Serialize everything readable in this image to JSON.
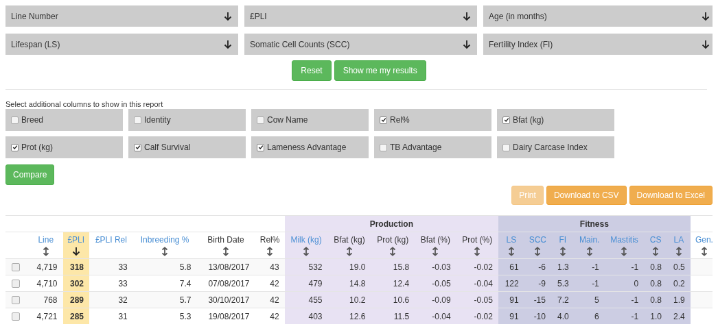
{
  "filters": [
    {
      "label": "Line Number"
    },
    {
      "label": "£PLI"
    },
    {
      "label": "Age (in months)"
    },
    {
      "label": "Lifespan (LS)"
    },
    {
      "label": "Somatic Cell Counts (SCC)"
    },
    {
      "label": "Fertility Index (FI)"
    }
  ],
  "filter_buttons": [
    {
      "label": "Reset"
    },
    {
      "label": "Show me my results"
    }
  ],
  "columns_prompt": "Select additional columns to show in this report",
  "column_options": [
    {
      "label": "Breed",
      "checked": false
    },
    {
      "label": "Identity",
      "checked": false
    },
    {
      "label": "Cow Name",
      "checked": false
    },
    {
      "label": "Rel%",
      "checked": true
    },
    {
      "label": "Bfat (kg)",
      "checked": true
    },
    {
      "label": "Prot (kg)",
      "checked": true
    },
    {
      "label": "Calf Survival",
      "checked": true
    },
    {
      "label": "Lameness Advantage",
      "checked": true
    },
    {
      "label": "TB Advantage",
      "checked": false
    },
    {
      "label": "Dairy Carcase Index",
      "checked": false
    }
  ],
  "compare_button": "Compare",
  "export_buttons": [
    {
      "label": "Print",
      "disabled": true
    },
    {
      "label": "Download to CSV",
      "disabled": false
    },
    {
      "label": "Download to Excel",
      "disabled": false
    }
  ],
  "table": {
    "column_groups": [
      {
        "kind": "plain",
        "columns": [
          {
            "label": "Line",
            "link": true,
            "sortable": true,
            "sorted": false
          },
          {
            "label": "£PLI",
            "link": true,
            "sortable": true,
            "sorted": true
          },
          {
            "label": "£PLI Rel",
            "link": true,
            "sortable": false,
            "sorted": false
          },
          {
            "label": "Inbreeding %",
            "link": true,
            "sortable": true,
            "sorted": false
          },
          {
            "label": "Birth Date",
            "link": false,
            "sortable": true,
            "sorted": false
          },
          {
            "label": "Rel%",
            "link": false,
            "sortable": true,
            "sorted": false
          }
        ]
      },
      {
        "kind": "production",
        "label": "Production",
        "columns": [
          {
            "label": "Milk (kg)",
            "link": true,
            "sortable": true,
            "sorted": false
          },
          {
            "label": "Bfat (kg)",
            "link": false,
            "sortable": true,
            "sorted": false
          },
          {
            "label": "Prot (kg)",
            "link": false,
            "sortable": true,
            "sorted": false
          },
          {
            "label": "Bfat (%)",
            "link": false,
            "sortable": true,
            "sorted": false
          },
          {
            "label": "Prot (%)",
            "link": false,
            "sortable": true,
            "sorted": false
          }
        ]
      },
      {
        "kind": "fitness",
        "label": "Fitness",
        "columns": [
          {
            "label": "LS",
            "link": true,
            "sortable": true,
            "sorted": false
          },
          {
            "label": "SCC",
            "link": true,
            "sortable": true,
            "sorted": false
          },
          {
            "label": "FI",
            "link": true,
            "sortable": true,
            "sorted": false
          },
          {
            "label": "Main.",
            "link": true,
            "sortable": true,
            "sorted": false
          },
          {
            "label": "Mastitis",
            "link": true,
            "sortable": true,
            "sorted": false
          },
          {
            "label": "CS",
            "link": true,
            "sortable": true,
            "sorted": false
          },
          {
            "label": "LA",
            "link": true,
            "sortable": true,
            "sorted": false
          }
        ]
      },
      {
        "kind": "plain",
        "columns": [
          {
            "label": "Gen.",
            "link": true,
            "sortable": true,
            "sorted": false
          }
        ]
      }
    ],
    "rows": [
      {
        "selected": false,
        "cells": [
          "4,719",
          "318",
          "33",
          "5.8",
          "13/08/2017",
          "43",
          "532",
          "19.0",
          "15.8",
          "-0.03",
          "-0.02",
          "61",
          "-6",
          "1.3",
          "-1",
          "-1",
          "0.8",
          "0.5"
        ]
      },
      {
        "selected": false,
        "cells": [
          "4,710",
          "302",
          "33",
          "7.4",
          "07/08/2017",
          "42",
          "479",
          "14.8",
          "12.4",
          "-0.05",
          "-0.04",
          "122",
          "-9",
          "5.3",
          "-1",
          "0",
          "0.8",
          "0.2"
        ]
      },
      {
        "selected": false,
        "cells": [
          "768",
          "289",
          "32",
          "5.7",
          "30/10/2017",
          "42",
          "455",
          "10.2",
          "10.6",
          "-0.09",
          "-0.05",
          "91",
          "-15",
          "7.2",
          "5",
          "-1",
          "0.8",
          "1.9"
        ]
      },
      {
        "selected": false,
        "cells": [
          "4,721",
          "285",
          "31",
          "5.3",
          "19/08/2017",
          "42",
          "403",
          "12.6",
          "11.5",
          "-0.04",
          "-0.02",
          "91",
          "-10",
          "4.0",
          "6",
          "-1",
          "1.0",
          "2.4"
        ]
      }
    ]
  }
}
